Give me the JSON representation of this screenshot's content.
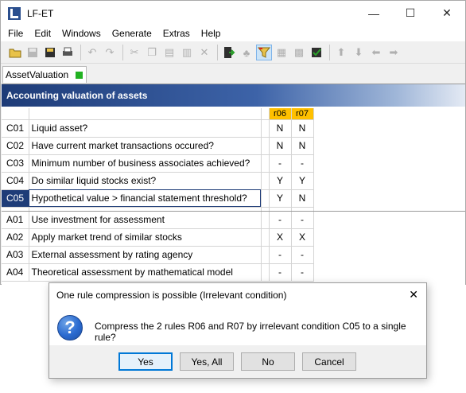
{
  "window": {
    "title": "LF-ET",
    "controls": {
      "minimize": "—",
      "maximize": "☐",
      "close": "✕"
    }
  },
  "menu": [
    {
      "key": "F",
      "rest": "ile"
    },
    {
      "key": "E",
      "rest": "dit"
    },
    {
      "key": "W",
      "rest": "indows"
    },
    {
      "key": "",
      "pre": "Generate",
      "rest": ""
    },
    {
      "key": "E",
      "pre": "",
      "rest": "xtras"
    },
    {
      "key": "H",
      "rest": "elp"
    }
  ],
  "menu_labels": [
    "File",
    "Edit",
    "Windows",
    "Generate",
    "Extras",
    "Help"
  ],
  "tab": {
    "label": "AssetValuation",
    "status_color": "#22b222"
  },
  "table": {
    "title": "Accounting valuation of assets",
    "rule_headers": [
      "r06",
      "r07"
    ],
    "conditions": [
      {
        "id": "C01",
        "text": "Liquid asset?",
        "r06": "N",
        "r07": "N"
      },
      {
        "id": "C02",
        "text": "Have current market transactions occured?",
        "r06": "N",
        "r07": "N"
      },
      {
        "id": "C03",
        "text": "Minimum number of business associates achieved?",
        "r06": "-",
        "r07": "-"
      },
      {
        "id": "C04",
        "text": "Do similar liquid stocks exist?",
        "r06": "Y",
        "r07": "Y"
      },
      {
        "id": "C05",
        "text": "Hypothetical value > financial statement threshold?",
        "r06": "Y",
        "r07": "N"
      }
    ],
    "actions": [
      {
        "id": "A01",
        "text": "Use investment for assessment",
        "r06": "-",
        "r07": "-"
      },
      {
        "id": "A02",
        "text": "Apply market trend of similar stocks",
        "r06": "X",
        "r07": "X"
      },
      {
        "id": "A03",
        "text": "External assessment by rating agency",
        "r06": "-",
        "r07": "-"
      },
      {
        "id": "A04",
        "text": "Theoretical assessment by mathematical model",
        "r06": "-",
        "r07": "-"
      }
    ]
  },
  "dialog": {
    "title": "One rule compression is possible (Irrelevant condition)",
    "message": "Compress the 2 rules R06 and R07 by irrelevant condition C05 to a single rule?",
    "buttons": {
      "yes": "Yes",
      "yes_all": "Yes, All",
      "no": "No",
      "cancel": "Cancel"
    }
  },
  "colors": {
    "header_start": "#1e3c78",
    "rule_header": "#ffc000",
    "selected_row": "#1e3c78"
  }
}
